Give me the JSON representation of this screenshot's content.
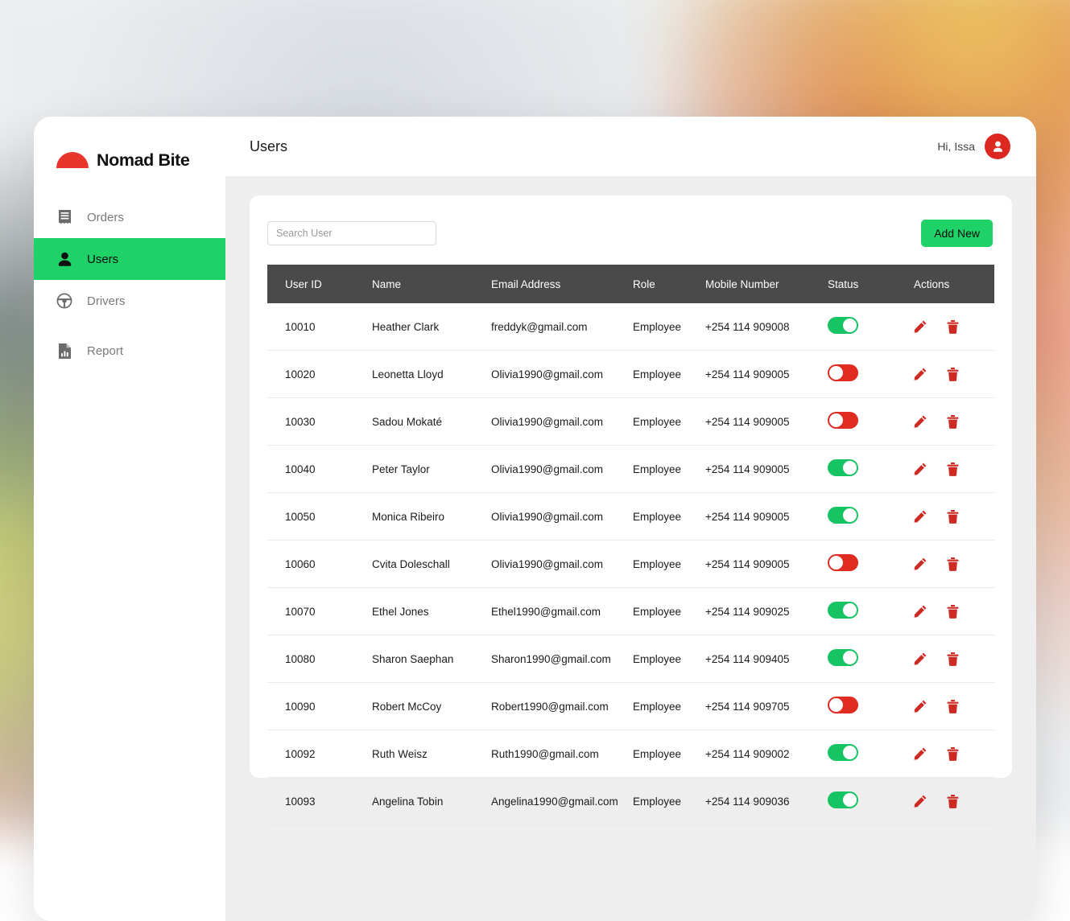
{
  "brand": {
    "name": "Nomad Bite",
    "mark": "red-dome-logo",
    "mark_color": "#e8352b"
  },
  "sidebar": {
    "items": [
      {
        "label": "Orders",
        "icon": "receipt-icon",
        "active": false
      },
      {
        "label": "Users",
        "icon": "person-icon",
        "active": true
      },
      {
        "label": "Drivers",
        "icon": "steering-wheel-icon",
        "active": false
      },
      {
        "label": "Report",
        "icon": "report-chart-icon",
        "active": false
      }
    ],
    "active_color": "#1ed268"
  },
  "topbar": {
    "title": "Users",
    "greeting": "Hi, Issa",
    "avatar_icon": "user-avatar-icon",
    "avatar_color": "#dd2822"
  },
  "toolbar": {
    "search_placeholder": "Search User",
    "search_value": "",
    "add_new_label": "Add New",
    "add_new_color": "#1ed268"
  },
  "table": {
    "columns": [
      "User ID",
      "Name",
      "Email Address",
      "Role",
      "Mobile Number",
      "Status",
      "Actions"
    ],
    "header_bg": "#4a4a4a",
    "edit_icon": "pencil-icon",
    "delete_icon": "trash-icon",
    "action_color": "#cc2a22",
    "status_on_color": "#16c464",
    "status_off_color": "#e02b20",
    "rows": [
      {
        "user_id": "10010",
        "name": "Heather Clark",
        "email": "freddyk@gmail.com",
        "role": "Employee",
        "mobile": "+254 114 909008",
        "status": "on"
      },
      {
        "user_id": "10020",
        "name": "Leonetta Lloyd",
        "email": "Olivia1990@gmail.com",
        "role": "Employee",
        "mobile": "+254 114 909005",
        "status": "off"
      },
      {
        "user_id": "10030",
        "name": "Sadou Mokaté",
        "email": "Olivia1990@gmail.com",
        "role": "Employee",
        "mobile": "+254 114 909005",
        "status": "off"
      },
      {
        "user_id": "10040",
        "name": "Peter Taylor",
        "email": "Olivia1990@gmail.com",
        "role": "Employee",
        "mobile": "+254 114 909005",
        "status": "on"
      },
      {
        "user_id": "10050",
        "name": "Monica Ribeiro",
        "email": "Olivia1990@gmail.com",
        "role": "Employee",
        "mobile": "+254 114 909005",
        "status": "on"
      },
      {
        "user_id": "10060",
        "name": "Cvita Doleschall",
        "email": "Olivia1990@gmail.com",
        "role": "Employee",
        "mobile": "+254 114 909005",
        "status": "off"
      },
      {
        "user_id": "10070",
        "name": "Ethel Jones",
        "email": "Ethel1990@gmail.com",
        "role": "Employee",
        "mobile": "+254 114 909025",
        "status": "on"
      },
      {
        "user_id": "10080",
        "name": "Sharon Saephan",
        "email": "Sharon1990@gmail.com",
        "role": "Employee",
        "mobile": "+254 114 909405",
        "status": "on"
      },
      {
        "user_id": "10090",
        "name": "Robert McCoy",
        "email": "Robert1990@gmail.com",
        "role": "Employee",
        "mobile": "+254 114 909705",
        "status": "off"
      },
      {
        "user_id": "10092",
        "name": "Ruth Weisz",
        "email": "Ruth1990@gmail.com",
        "role": "Employee",
        "mobile": "+254 114 909002",
        "status": "on"
      },
      {
        "user_id": "10093",
        "name": "Angelina Tobin",
        "email": "Angelina1990@gmail.com",
        "role": "Employee",
        "mobile": "+254 114 909036",
        "status": "on"
      }
    ]
  }
}
